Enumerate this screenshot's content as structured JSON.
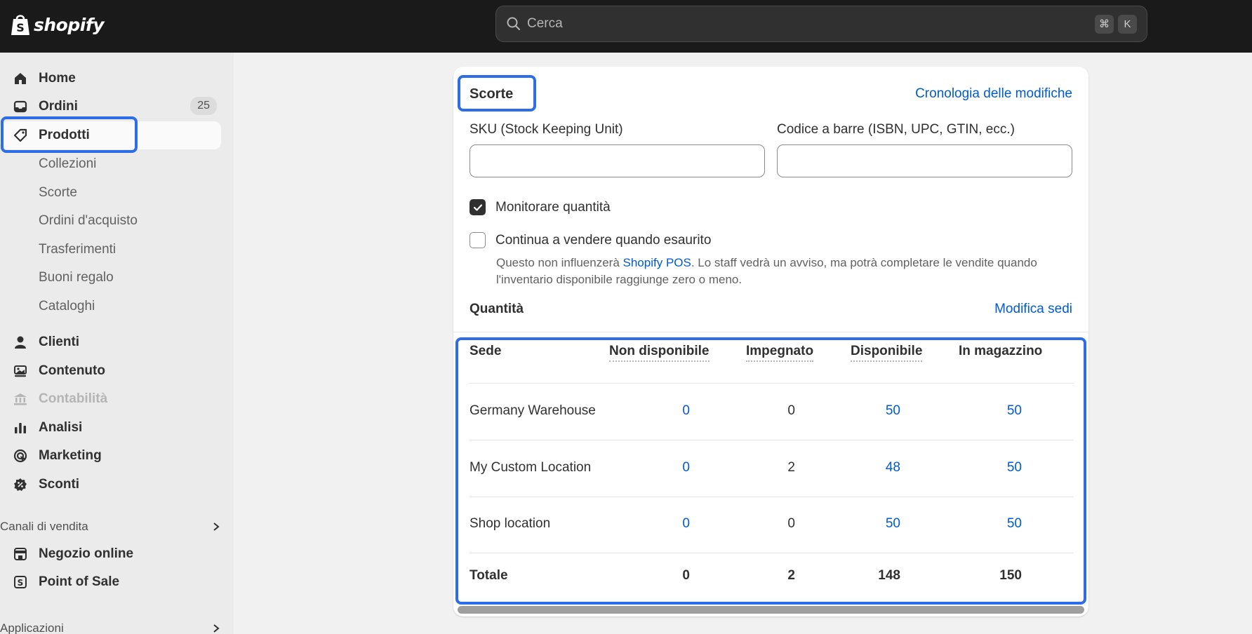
{
  "header": {
    "brand": "shopify",
    "search_placeholder": "Cerca",
    "shortcut_keys": [
      "⌘",
      "K"
    ]
  },
  "sidebar": {
    "items": [
      {
        "label": "Home",
        "icon": "home-icon"
      },
      {
        "label": "Ordini",
        "icon": "inbox-icon",
        "badge": "25"
      },
      {
        "label": "Prodotti",
        "icon": "tag-icon",
        "active": true
      },
      {
        "label": "Clienti",
        "icon": "person-icon"
      },
      {
        "label": "Contenuto",
        "icon": "content-icon"
      },
      {
        "label": "Contabilità",
        "icon": "bank-icon",
        "disabled": true
      },
      {
        "label": "Analisi",
        "icon": "bar-chart-icon"
      },
      {
        "label": "Marketing",
        "icon": "target-icon"
      },
      {
        "label": "Sconti",
        "icon": "discount-icon"
      }
    ],
    "product_subitems": [
      "Collezioni",
      "Scorte",
      "Ordini d'acquisto",
      "Trasferimenti",
      "Buoni regalo",
      "Cataloghi"
    ],
    "sales_channels_label": "Canali di vendita",
    "sales_channels": [
      {
        "label": "Negozio online",
        "icon": "store-icon"
      },
      {
        "label": "Point of Sale",
        "icon": "pos-icon"
      }
    ],
    "apps_label": "Applicazioni"
  },
  "inventory": {
    "title": "Scorte",
    "history_link": "Cronologia delle modifiche",
    "sku_label": "SKU (Stock Keeping Unit)",
    "sku_value": "",
    "barcode_label": "Codice a barre (ISBN, UPC, GTIN, ecc.)",
    "barcode_value": "",
    "track_quantity_label": "Monitorare quantità",
    "track_quantity_checked": true,
    "continue_selling_label": "Continua a vendere quando esaurito",
    "continue_selling_checked": false,
    "help_text_before": "Questo non influenzerà ",
    "help_link": "Shopify POS",
    "help_text_after": ". Lo staff vedrà un avviso, ma potrà completare le vendite quando l'inventario disponibile raggiunge zero o meno.",
    "quantity_title": "Quantità",
    "edit_locations_link": "Modifica sedi",
    "table": {
      "headers": [
        "Sede",
        "Non disponibile",
        "Impegnato",
        "Disponibile",
        "In magazzino"
      ],
      "rows": [
        [
          "Germany Warehouse",
          "0",
          "0",
          "50",
          "50"
        ],
        [
          "My Custom Location",
          "0",
          "2",
          "48",
          "50"
        ],
        [
          "Shop location",
          "0",
          "0",
          "50",
          "50"
        ]
      ],
      "totals": [
        "Totale",
        "0",
        "2",
        "148",
        "150"
      ]
    }
  },
  "colors": {
    "topbar": "#1a1a1a",
    "link": "#005bd3",
    "highlight": "#2e6de8"
  }
}
